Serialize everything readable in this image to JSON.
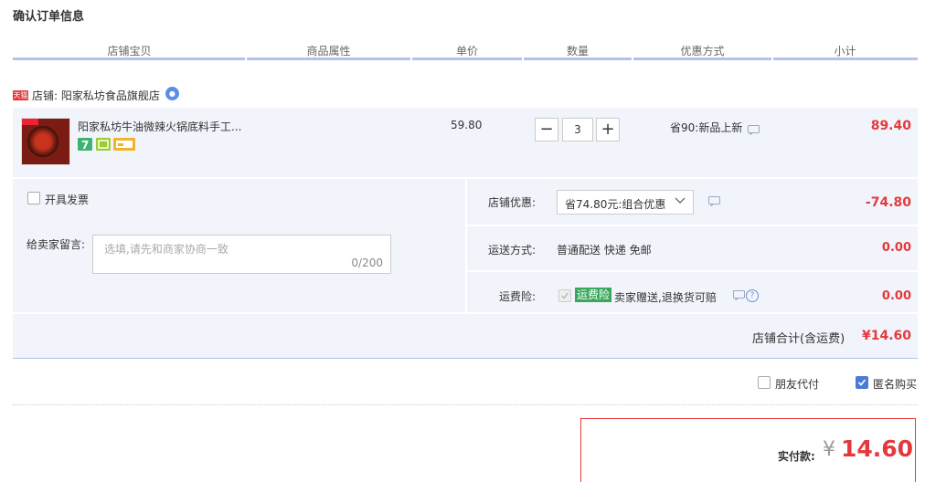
{
  "page_title": "确认订单信息",
  "columns": [
    "店铺宝贝",
    "商品属性",
    "单价",
    "数量",
    "优惠方式",
    "小计"
  ],
  "store": {
    "badge": "天猫",
    "label": "店铺: 阳家私坊食品旗舰店"
  },
  "item": {
    "name": "阳家私坊牛油微辣火锅底料手工...",
    "unit_price": "59.80",
    "quantity": "3",
    "minus": "−",
    "plus": "+",
    "promo": "省90:新品上新",
    "subtotal": "89.40"
  },
  "invoice": {
    "label": "开具发票",
    "checked": false
  },
  "message": {
    "label": "给卖家留言:",
    "placeholder": "选填,请先和商家协商一致",
    "count": "0/200"
  },
  "shop_discount": {
    "label": "店铺优惠:",
    "selected": "省74.80元:组合优惠",
    "amount": "-74.80"
  },
  "shipping": {
    "label": "运送方式:",
    "value": "普通配送 快递 免邮",
    "amount": "0.00"
  },
  "insurance": {
    "label": "运费险:",
    "tag": "运费险",
    "text": "卖家赠送,退换货可赔",
    "help": "?",
    "amount": "0.00"
  },
  "store_total": {
    "label": "店铺合计(含运费)",
    "amount": "¥14.60"
  },
  "options": {
    "friend_pay": {
      "label": "朋友代付",
      "checked": false
    },
    "anonymous": {
      "label": "匿名购买",
      "checked": true
    }
  },
  "payment": {
    "label": "实付款:",
    "currency": "¥",
    "amount": "14.60"
  },
  "colors": {
    "accent_red": "#e4393c",
    "header_line": "#b2c2e8",
    "panel_bg": "#f2f4fb",
    "insurance_green": "#37a85b"
  }
}
